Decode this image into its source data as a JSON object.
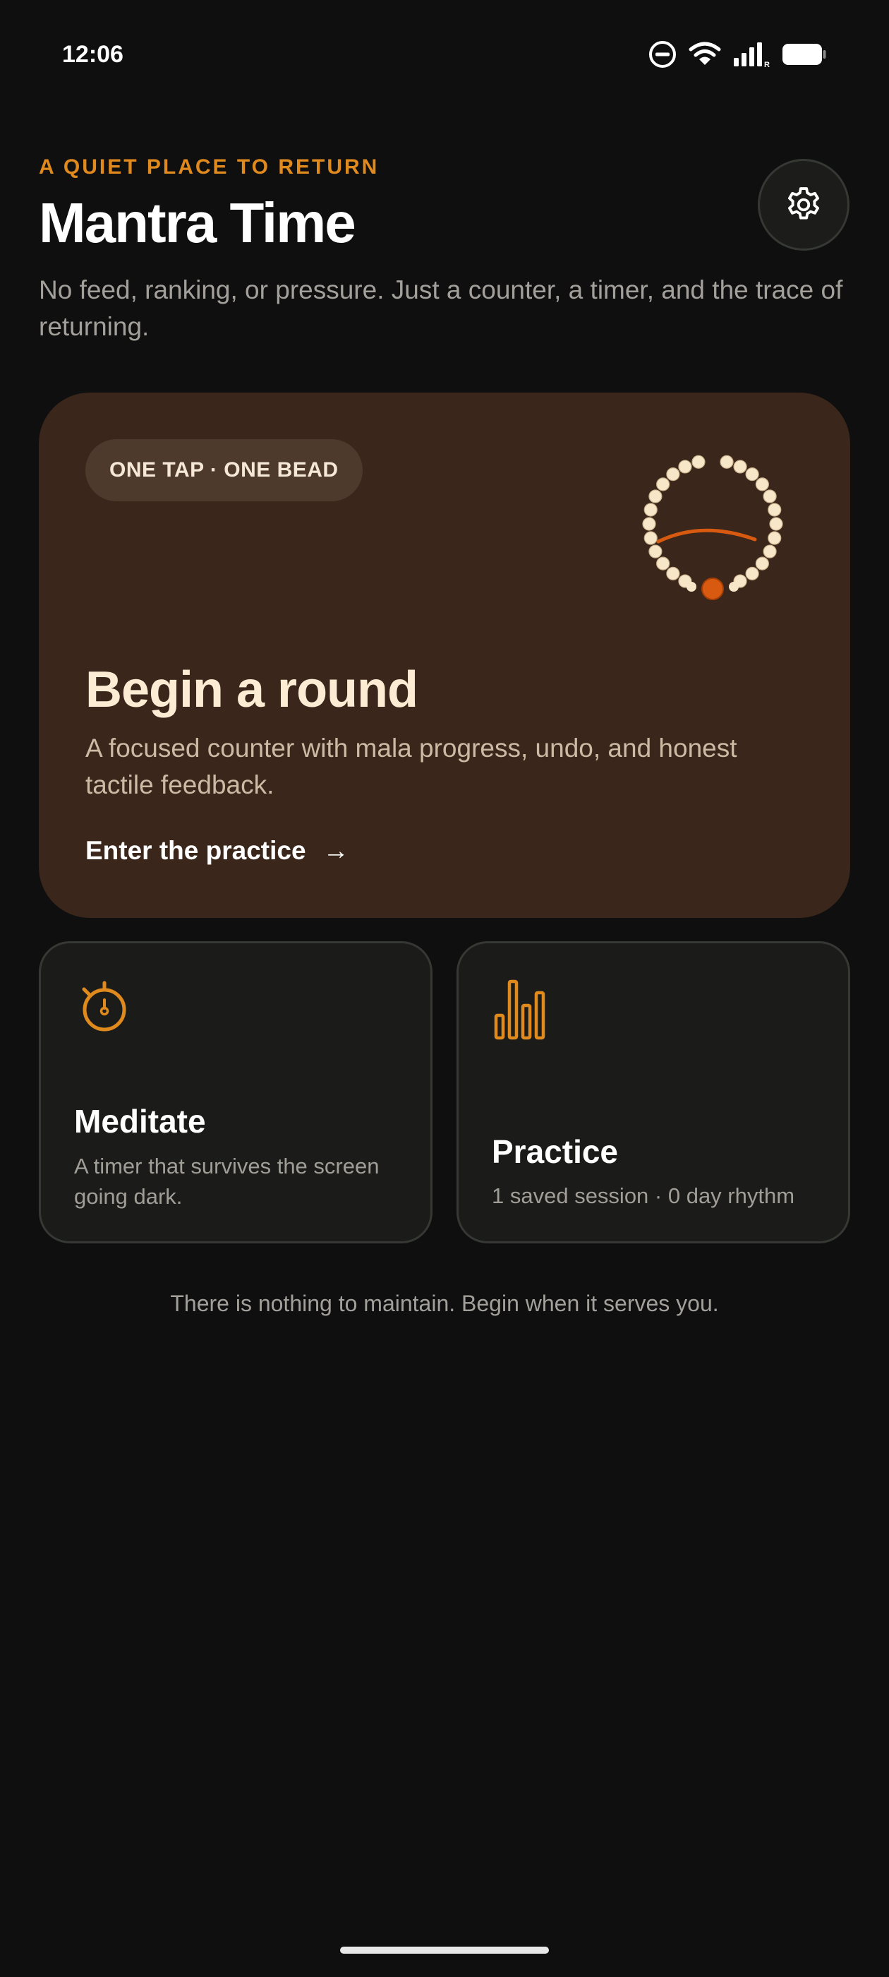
{
  "status_bar": {
    "time": "12:06",
    "icons": [
      "do-not-disturb-icon",
      "wifi-icon",
      "signal-icon",
      "battery-icon"
    ]
  },
  "header": {
    "eyebrow": "A QUIET PLACE TO RETURN",
    "title": "Mantra Time",
    "subtitle": "No feed, ranking, or pressure. Just a counter, a timer, and the trace of returning.",
    "settings_icon": "gear-icon"
  },
  "hero": {
    "pill": "ONE TAP · ONE BEAD",
    "title": "Begin a round",
    "description": "A focused counter with mala progress, undo, and honest tactile feedback.",
    "cta": "Enter the practice",
    "cta_arrow": "→",
    "icon": "mala-beads-icon"
  },
  "cards": {
    "meditate": {
      "title": "Meditate",
      "description": "A timer that survives the screen going dark.",
      "icon": "stopwatch-icon"
    },
    "practice": {
      "title": "Practice",
      "description": "1 saved session · 0 day rhythm",
      "icon": "bar-chart-icon"
    }
  },
  "footer": "There is nothing to maintain. Begin when it serves you.",
  "colors": {
    "background": "#0f0f0f",
    "accent": "#e08a1e",
    "hero_card": "#3a261a",
    "bead": "#f8e6c8",
    "guru_bead": "#d85a10"
  }
}
